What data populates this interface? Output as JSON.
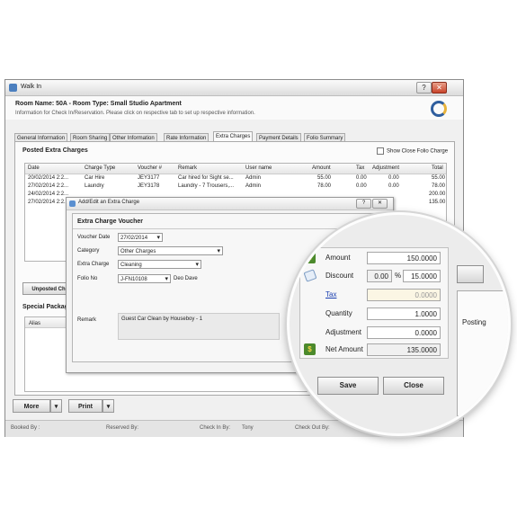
{
  "window": {
    "title": "Walk In",
    "room_title": "Room Name: 50A - Room Type: Small Studio Apartment",
    "info_text": "Information for Check In/Reservation. Please click on respective tab to set up respective information."
  },
  "tabs": [
    "General Information",
    "Room Sharing",
    "Other Information",
    "Rate Information",
    "Extra Charges",
    "Payment Details",
    "Folio Summary"
  ],
  "posted": {
    "title": "Posted Extra Charges",
    "show_close_label": "Show Close Folio Charge",
    "columns": [
      "Date",
      "Charge Type",
      "Voucher #",
      "Remark",
      "User name",
      "Amount",
      "Tax",
      "Adjustment",
      "Total"
    ],
    "rows": [
      {
        "date": "20/02/2014 2:2...",
        "type": "Car Hire",
        "voucher": "JEY3177",
        "remark": "Car hired for Sight se...",
        "user": "Admin",
        "amount": "55.00",
        "tax": "0.00",
        "adj": "0.00",
        "total": "55.00"
      },
      {
        "date": "27/02/2014 2:2...",
        "type": "Laundry",
        "voucher": "JEY3178",
        "remark": "Laundry - 7 Trousers,...",
        "user": "Admin",
        "amount": "78.00",
        "tax": "0.00",
        "adj": "0.00",
        "total": "78.00"
      },
      {
        "date": "24/02/2014 2:2...",
        "type": "",
        "voucher": "",
        "remark": "",
        "user": "",
        "amount": "",
        "tax": "",
        "adj": "",
        "total": "200.00"
      },
      {
        "date": "27/02/2014 2:2...",
        "type": "",
        "voucher": "",
        "remark": "",
        "user": "",
        "amount": "",
        "tax": "",
        "adj": "",
        "total": "135.00"
      }
    ]
  },
  "unposted_label": "Unposted Ch",
  "special": {
    "title": "Special Package",
    "alias_col": "Alias",
    "posting_col": "Posting"
  },
  "buttons": {
    "more": "More",
    "print": "Print",
    "dropdown": "▾"
  },
  "status": {
    "booked_by": "Booked By :",
    "reserved_by": "Reserved By:",
    "check_in_by": "Check In By:",
    "check_in_user": "Tony",
    "check_out_by": "Check Out By:"
  },
  "dialog": {
    "title": "Add/Edit an Extra Charge",
    "group_title": "Extra Charge Voucher",
    "voucher_date_label": "Voucher Date",
    "voucher_date": "27/02/2014",
    "category_label": "Category",
    "category": "Other Charges",
    "extra_charge_label": "Extra Charge",
    "extra_charge": "Cleaning",
    "folio_label": "Folio No",
    "folio": "J-FN10108",
    "folio_name": "Deo Dave",
    "remark_label": "Remark",
    "remark": "Guest Car Clean by Houseboy - 1"
  },
  "magnifier": {
    "amount_label": "Amount",
    "amount": "150.0000",
    "discount_label": "Discount",
    "discount_pct": "0.00",
    "pct_sign": "%",
    "discount": "15.0000",
    "tax_label": "Tax",
    "tax": "0.0000",
    "quantity_label": "Quantity",
    "quantity": "1.0000",
    "adjustment_label": "Adjustment",
    "adjustment": "0.0000",
    "net_label": "Net Amount",
    "net": "135.0000",
    "save": "Save",
    "close": "Close",
    "posting": "Posting"
  },
  "colors": {
    "accent": "#2f5e9e",
    "icon_green": "#4c8a2c",
    "link": "#1a3fb0"
  }
}
